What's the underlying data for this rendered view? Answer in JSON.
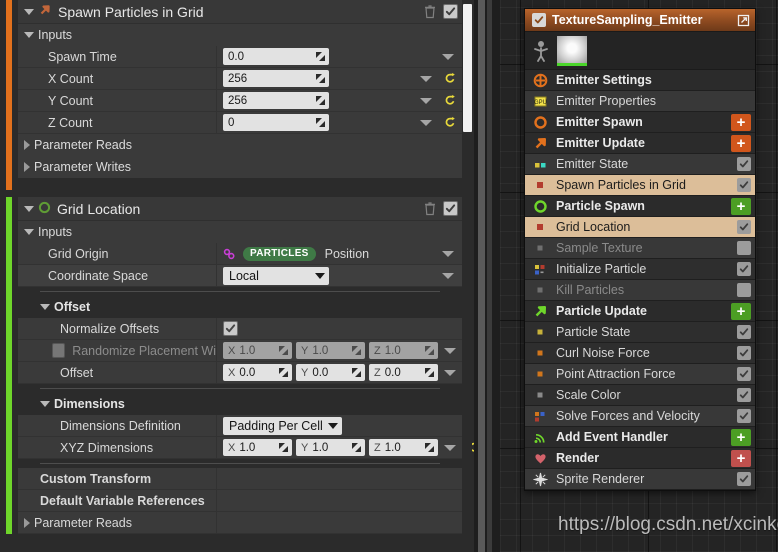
{
  "details_panel": {
    "modules": [
      {
        "title": "Spawn Particles in Grid",
        "accent": "#e2711d",
        "icon": "arrow-up-right-icon",
        "delete_tooltip": "Delete",
        "enabled": true,
        "sections": [
          {
            "label": "Inputs",
            "expanded": true
          },
          {
            "label": "Parameter Reads",
            "expanded": false
          },
          {
            "label": "Parameter Writes",
            "expanded": false
          }
        ],
        "rows": [
          {
            "name": "Spawn Time",
            "value": "0.0",
            "kind": "number",
            "reset": false
          },
          {
            "name": "X Count",
            "value": "256",
            "kind": "number",
            "reset": true
          },
          {
            "name": "Y Count",
            "value": "256",
            "kind": "number",
            "reset": true
          },
          {
            "name": "Z Count",
            "value": "0",
            "kind": "number",
            "reset": true
          }
        ]
      },
      {
        "title": "Grid Location",
        "accent": "#6fd62b",
        "icon": "circle-outline-icon",
        "enabled": true,
        "inputs_label": "Inputs",
        "grid_origin": {
          "name": "Grid Origin",
          "namespace": "PARTICLES",
          "attribute": "Position",
          "namespace_color": "#3f7a46"
        },
        "coordinate_space": {
          "name": "Coordinate Space",
          "value": "Local"
        },
        "offset_group": {
          "label": "Offset",
          "normalize": {
            "name": "Normalize Offsets",
            "checked": true
          },
          "randomize": {
            "name": "Randomize Placement Wi",
            "checked": false,
            "disabled": true,
            "x": "1.0",
            "y": "1.0",
            "z": "1.0"
          },
          "offset": {
            "name": "Offset",
            "x": "0.0",
            "y": "0.0",
            "z": "0.0"
          }
        },
        "dimensions_group": {
          "label": "Dimensions",
          "definition": {
            "name": "Dimensions Definition",
            "value": "Padding Per Cell"
          },
          "xyz": {
            "name": "XYZ Dimensions",
            "x": "1.0",
            "y": "1.0",
            "z": "1.0",
            "reset": true
          }
        },
        "footer_rows": [
          {
            "label": "Custom Transform",
            "bold": true,
            "expandable": false
          },
          {
            "label": "Default Variable References",
            "bold": true,
            "expandable": false
          },
          {
            "label": "Parameter Reads",
            "bold": false,
            "expandable": true
          }
        ]
      }
    ],
    "axes": {
      "x": "X",
      "y": "Y",
      "z": "Z"
    }
  },
  "emitter_stack": {
    "header": {
      "title": "TextureSampling_Emitter",
      "enabled": true,
      "popout_icon": "open-in-new-icon"
    },
    "thumbnails": {
      "person_icon": "local-space-person-icon",
      "sprite_icon": "sprite-thumbnail-icon"
    },
    "rows": [
      {
        "label": "Emitter Settings",
        "type": "group",
        "icon": "emitter-settings-icon",
        "icon_color": "#e2711d",
        "action": "none"
      },
      {
        "label": "Emitter Properties",
        "type": "module",
        "icon": "gpu-icon",
        "icon_color": "#ffe14d",
        "action": "none",
        "striped": true
      },
      {
        "label": "Emitter Spawn",
        "type": "group",
        "icon": "circle-outline-icon",
        "icon_color": "#e2711d",
        "action": "plus-orange"
      },
      {
        "label": "Emitter Update",
        "type": "group",
        "icon": "arrow-up-right-icon",
        "icon_color": "#e2711d",
        "action": "plus-orange"
      },
      {
        "label": "Emitter State",
        "type": "module",
        "icon": "two-squares-icon",
        "icon_color": "#d9c23a",
        "action": "check-on",
        "striped": true
      },
      {
        "label": "Spawn Particles in Grid",
        "type": "module",
        "icon": "red-square-icon",
        "icon_color": "#b33c2e",
        "action": "check-on",
        "selected": true
      },
      {
        "label": "Particle Spawn",
        "type": "group",
        "icon": "circle-outline-icon",
        "icon_color": "#6fd62b",
        "action": "plus-green"
      },
      {
        "label": "Grid Location",
        "type": "module",
        "icon": "red-square-icon",
        "icon_color": "#b33c2e",
        "action": "check-on",
        "selected": true
      },
      {
        "label": "Sample Texture",
        "type": "module",
        "icon": "gray-square-icon",
        "icon_color": "#6f6f6f",
        "action": "check-off",
        "disabled": true,
        "striped": true
      },
      {
        "label": "Initialize Particle",
        "type": "module",
        "icon": "multi-square-icon",
        "icon_color": "#c8b23a",
        "action": "check-on"
      },
      {
        "label": "Kill Particles",
        "type": "module",
        "icon": "gray-square-icon",
        "icon_color": "#6f6f6f",
        "action": "check-off",
        "disabled": true,
        "striped": true
      },
      {
        "label": "Particle Update",
        "type": "group",
        "icon": "arrow-up-right-icon",
        "icon_color": "#6fd62b",
        "action": "plus-green"
      },
      {
        "label": "Particle State",
        "type": "module",
        "icon": "yellow-square-icon",
        "icon_color": "#c8b23a",
        "action": "check-on"
      },
      {
        "label": "Curl Noise Force",
        "type": "module",
        "icon": "orange-square-icon",
        "icon_color": "#d1761c",
        "action": "check-on"
      },
      {
        "label": "Point Attraction Force",
        "type": "module",
        "icon": "orange-square-icon",
        "icon_color": "#d1761c",
        "action": "check-on",
        "striped": true
      },
      {
        "label": "Scale Color",
        "type": "module",
        "icon": "gray-square-icon",
        "icon_color": "#8a8a8a",
        "action": "check-on"
      },
      {
        "label": "Solve Forces and Velocity",
        "type": "module",
        "icon": "multi-square-icon",
        "icon_color": "#d1761c",
        "action": "check-on",
        "striped": true
      },
      {
        "label": "Add Event Handler",
        "type": "group",
        "icon": "event-waves-icon",
        "icon_color": "#6fd62b",
        "action": "plus-green"
      },
      {
        "label": "Render",
        "type": "group",
        "icon": "render-heart-icon",
        "icon_color": "#d4636b",
        "action": "plus-red"
      },
      {
        "label": "Sprite Renderer",
        "type": "module",
        "icon": "sparkle-icon",
        "icon_color": "#d8d8d8",
        "action": "check-on",
        "striped": true
      }
    ]
  },
  "watermark": {
    "text": "https://blog.csdn.net/xcinkey"
  }
}
